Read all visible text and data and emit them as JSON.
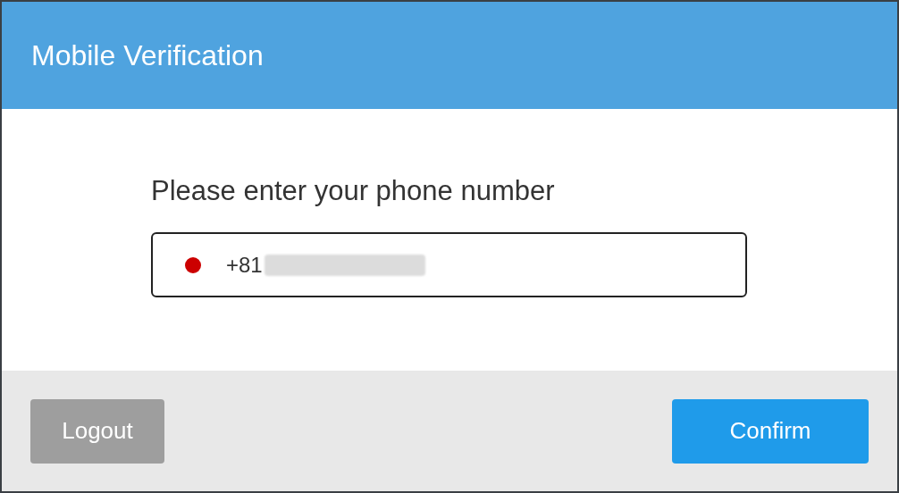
{
  "dialog": {
    "title": "Mobile Verification"
  },
  "prompt": "Please enter your phone number",
  "phone_field": {
    "value": "+81",
    "redacted": true
  },
  "buttons": [
    {
      "label": "Logout",
      "kind": "secondary"
    },
    {
      "label": "Confirm",
      "kind": "primary"
    }
  ]
}
